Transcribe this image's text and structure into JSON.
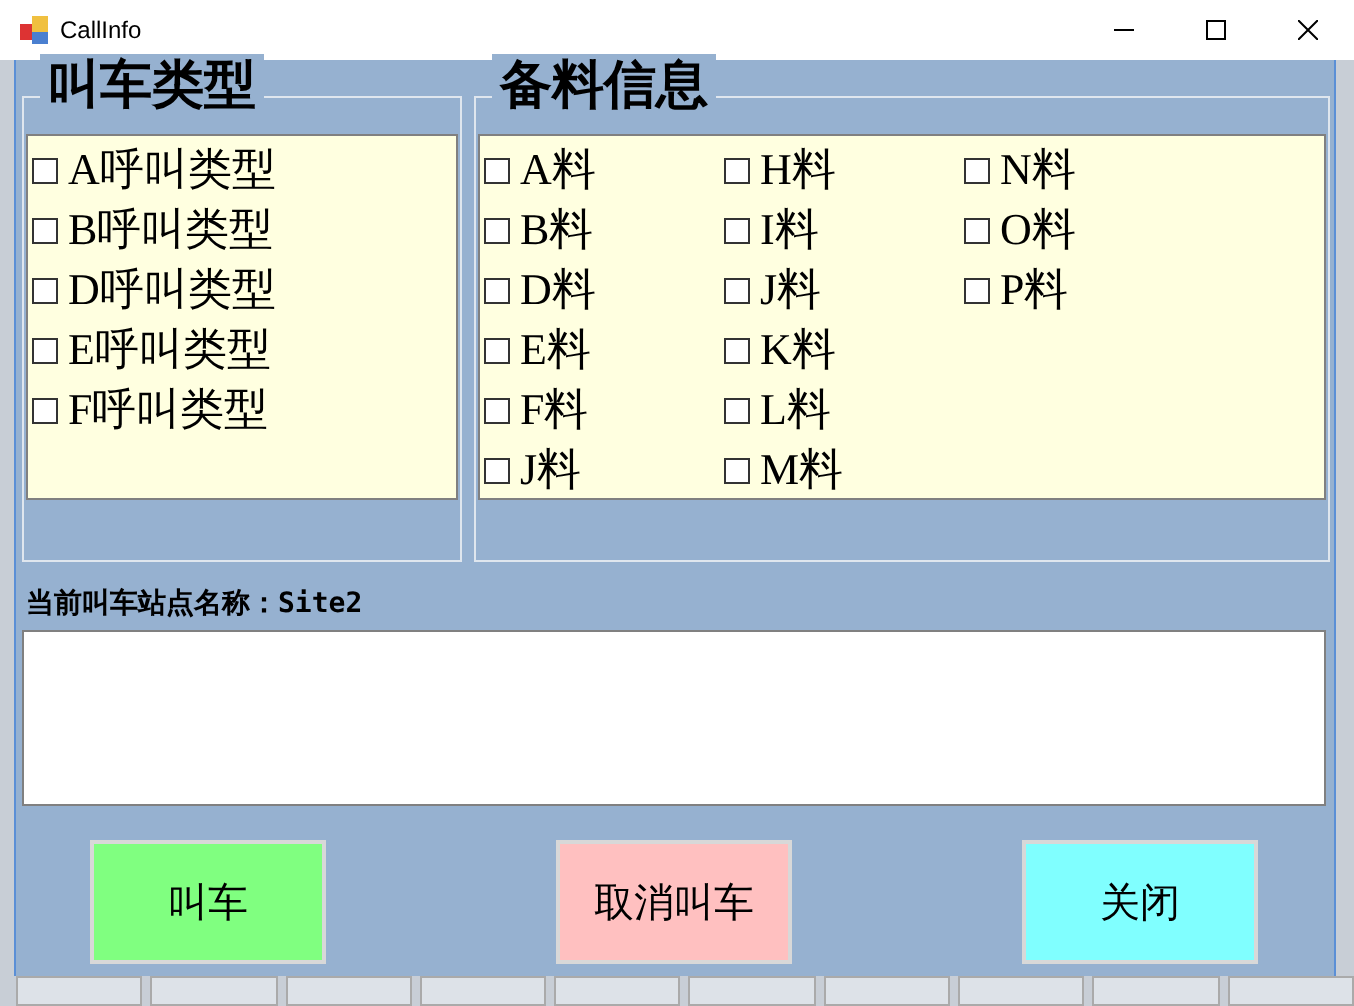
{
  "window": {
    "title": "CallInfo"
  },
  "call_types": {
    "title": "叫车类型",
    "items": [
      {
        "label": "A呼叫类型",
        "checked": false
      },
      {
        "label": "B呼叫类型",
        "checked": false
      },
      {
        "label": "D呼叫类型",
        "checked": false
      },
      {
        "label": "E呼叫类型",
        "checked": false
      },
      {
        "label": "F呼叫类型",
        "checked": false
      }
    ]
  },
  "materials": {
    "title": "备料信息",
    "columns": [
      [
        {
          "label": "A料",
          "checked": false
        },
        {
          "label": "B料",
          "checked": false
        },
        {
          "label": "D料",
          "checked": false
        },
        {
          "label": "E料",
          "checked": false
        },
        {
          "label": "F料",
          "checked": false
        },
        {
          "label": "J料",
          "checked": false
        }
      ],
      [
        {
          "label": "H料",
          "checked": false
        },
        {
          "label": "I料",
          "checked": false
        },
        {
          "label": "J料",
          "checked": false
        },
        {
          "label": "K料",
          "checked": false
        },
        {
          "label": "L料",
          "checked": false
        },
        {
          "label": "M料",
          "checked": false
        }
      ],
      [
        {
          "label": "N料",
          "checked": false
        },
        {
          "label": "O料",
          "checked": false
        },
        {
          "label": "P料",
          "checked": false
        }
      ]
    ]
  },
  "station_label": "当前叫车站点名称：Site2",
  "buttons": [
    {
      "label": "叫车",
      "color": "#80ff80"
    },
    {
      "label": "取消叫车",
      "color": "#ffc0c0"
    },
    {
      "label": "关闭",
      "color": "#80ffff"
    }
  ]
}
